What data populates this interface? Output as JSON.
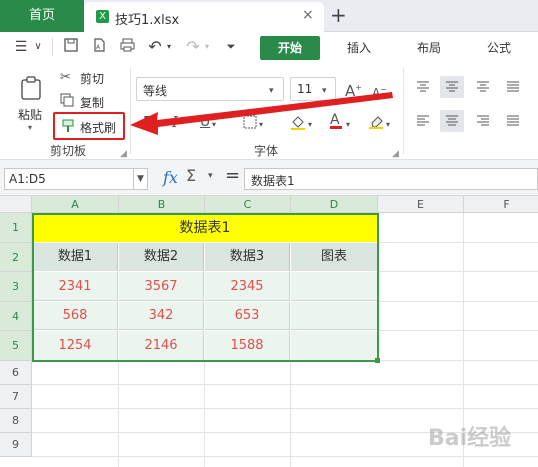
{
  "tabs": {
    "home": "首页",
    "file": "技巧1.xlsx",
    "file_icon": "X",
    "close": "×",
    "add": "+"
  },
  "menu": {
    "tabs": [
      "开始",
      "插入",
      "布局",
      "公式"
    ],
    "active": "开始"
  },
  "ribbon": {
    "clipboard": {
      "paste": "粘贴",
      "cut": "剪切",
      "copy": "复制",
      "format_painter": "格式刷",
      "group_label": "剪切板"
    },
    "font": {
      "font_name": "等线",
      "font_size": "11",
      "group_label": "字体"
    }
  },
  "formula_bar": {
    "name_box": "A1:D5",
    "fx": "fx",
    "sigma": "Σ",
    "equals": "=",
    "content": "数据表1"
  },
  "grid": {
    "columns": [
      "A",
      "B",
      "C",
      "D",
      "E",
      "F"
    ],
    "rows": [
      "1",
      "2",
      "3",
      "4",
      "5",
      "6",
      "7",
      "8",
      "9"
    ],
    "title": "数据表1",
    "headers": [
      "数据1",
      "数据2",
      "数据3",
      "图表"
    ],
    "data": [
      [
        "2341",
        "3567",
        "2345",
        ""
      ],
      [
        "568",
        "342",
        "653",
        ""
      ],
      [
        "1254",
        "2146",
        "1588",
        ""
      ]
    ]
  },
  "colors": {
    "accent_green": "#2a8a4a",
    "title_fill": "#ffff00",
    "header_fill": "#dbe5df",
    "data_fill": "#ebf5ee",
    "data_text": "#e05050",
    "annotation_red": "#e02020"
  }
}
